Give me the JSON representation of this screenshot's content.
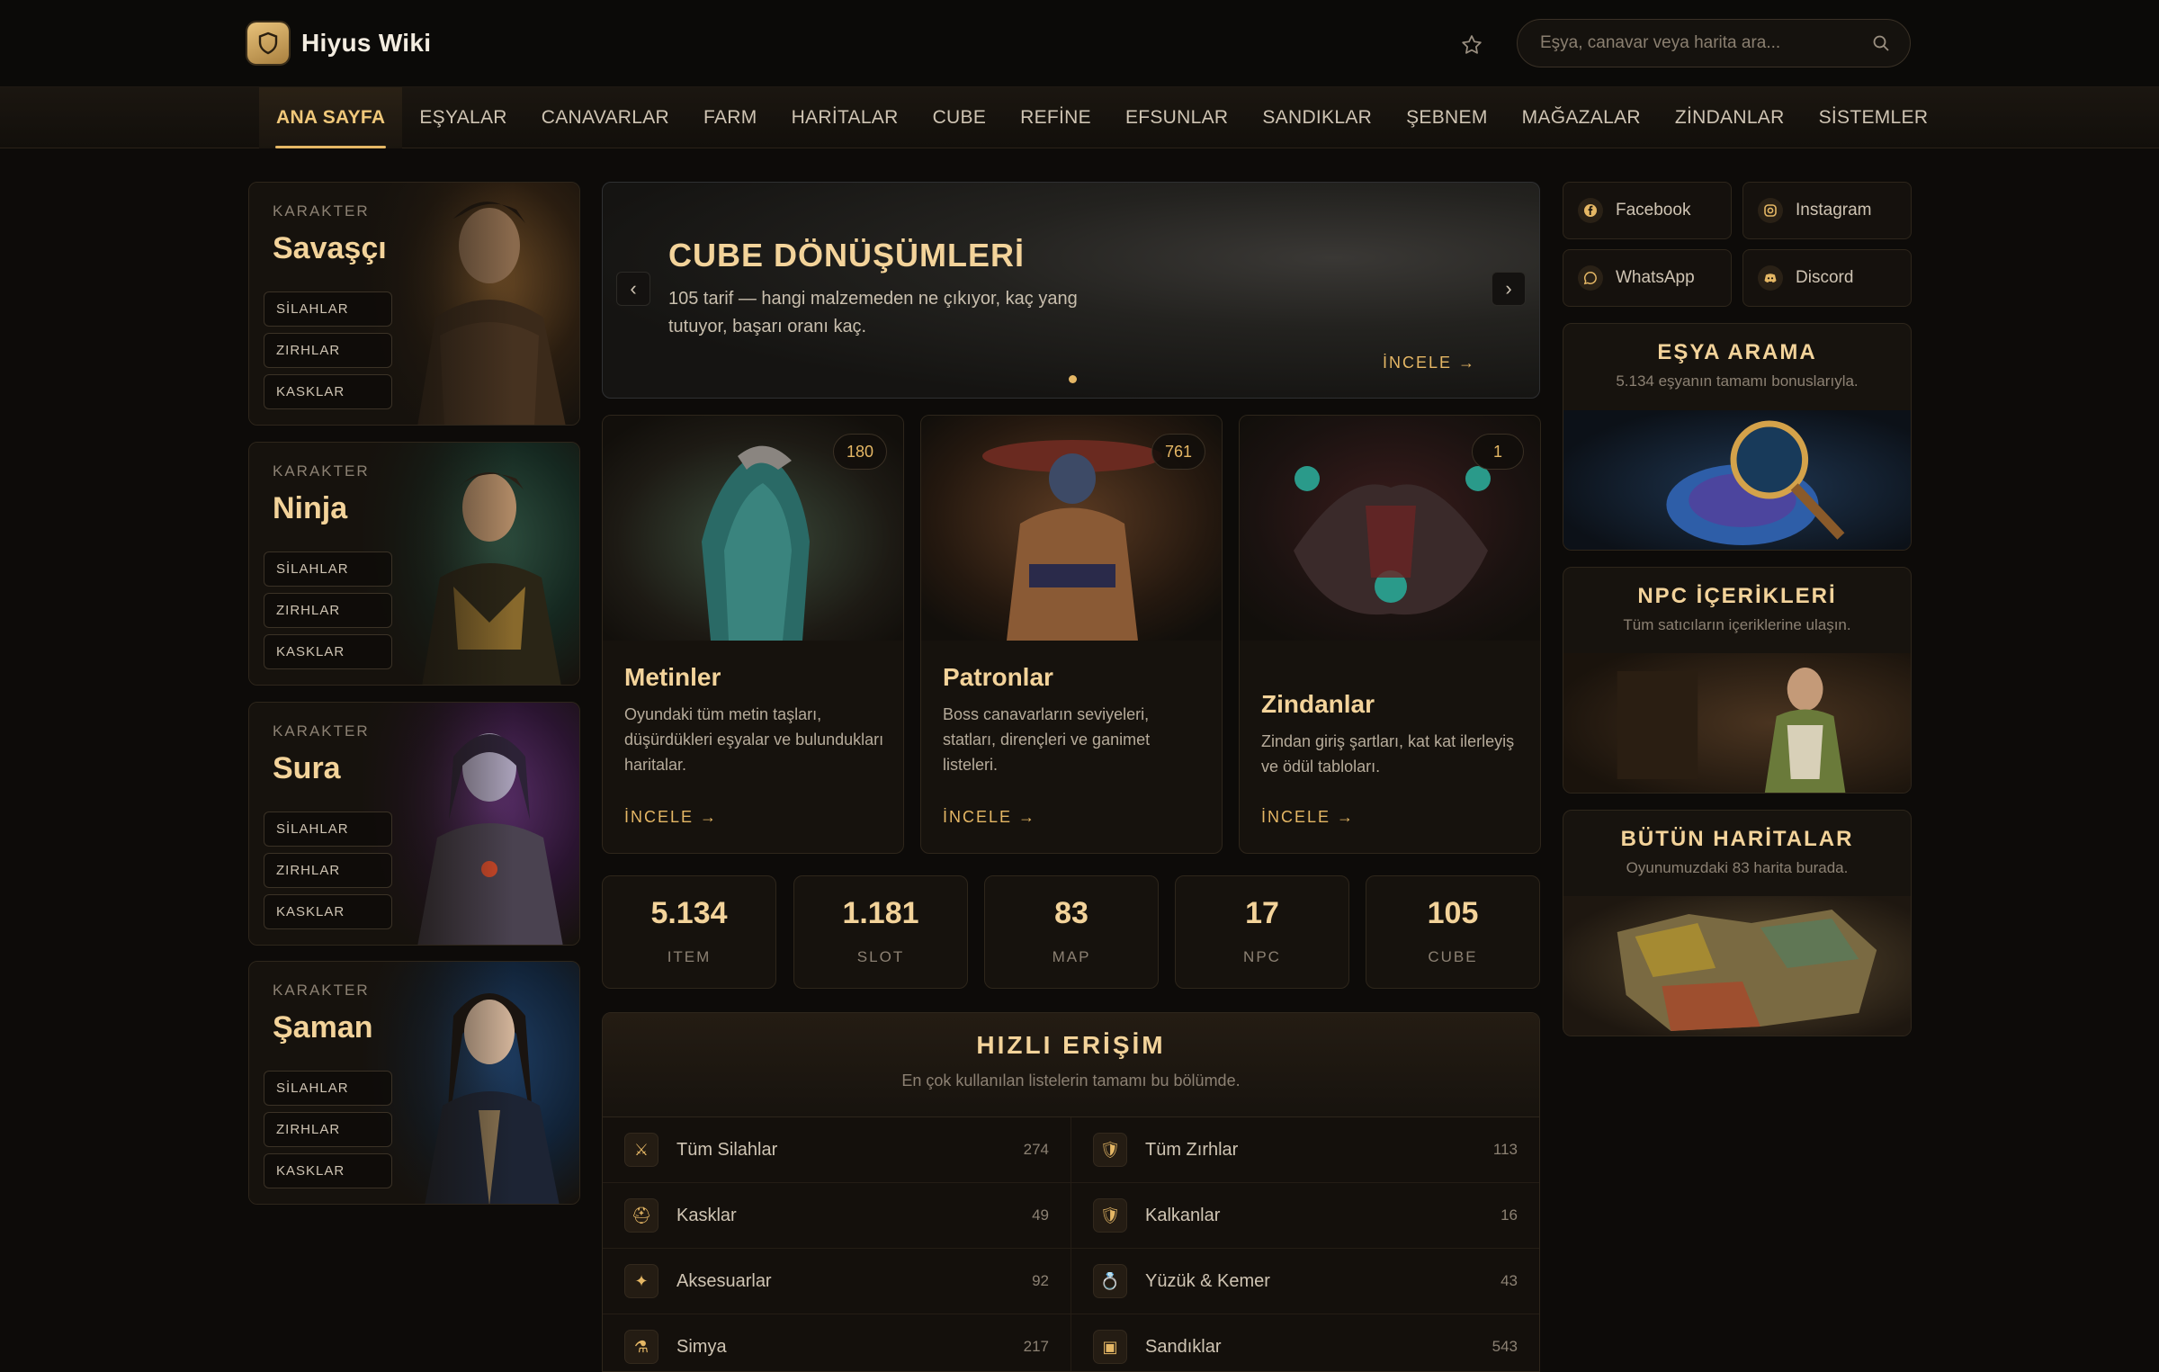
{
  "header": {
    "brand": "Hiyus Wiki",
    "search_placeholder": "Eşya, canavar veya harita ara..."
  },
  "nav": {
    "items": [
      "ANA SAYFA",
      "EŞYALAR",
      "CANAVARLAR",
      "FARM",
      "HARİTALAR",
      "CUBE",
      "REFİNE",
      "EFSUNLAR",
      "SANDIKLAR",
      "ŞEBNEM",
      "MAĞAZALAR",
      "ZİNDANLAR",
      "SİSTEMLER"
    ],
    "active": "ANA SAYFA"
  },
  "characters": [
    {
      "kicker": "KARAKTER",
      "name": "Savaşçı",
      "buttons": [
        "SİLAHLAR",
        "ZIRHLAR",
        "KASKLAR"
      ]
    },
    {
      "kicker": "KARAKTER",
      "name": "Ninja",
      "buttons": [
        "SİLAHLAR",
        "ZIRHLAR",
        "KASKLAR"
      ]
    },
    {
      "kicker": "KARAKTER",
      "name": "Sura",
      "buttons": [
        "SİLAHLAR",
        "ZIRHLAR",
        "KASKLAR"
      ]
    },
    {
      "kicker": "KARAKTER",
      "name": "Şaman",
      "buttons": [
        "SİLAHLAR",
        "ZIRHLAR",
        "KASKLAR"
      ]
    }
  ],
  "hero": {
    "title": "CUBE DÖNÜŞÜMLERİ",
    "description": "105 tarif — hangi malzemeden ne çıkıyor, kaç yang tutuyor, başarı oranı kaç.",
    "link": "İNCELE →",
    "prev": "‹",
    "next": "›"
  },
  "features": [
    {
      "title": "Metinler",
      "count": "180",
      "description": "Oyundaki tüm metin taşları, düşürdükleri eşyalar ve bulundukları haritalar.",
      "link": "İNCELE →"
    },
    {
      "title": "Patronlar",
      "count": "761",
      "description": "Boss canavarların seviyeleri, statları, dirençleri ve ganimet listeleri.",
      "link": "İNCELE →"
    },
    {
      "title": "Zindanlar",
      "count": "1",
      "description": "Zindan giriş şartları, kat kat ilerleyiş ve ödül tabloları.",
      "link": "İNCELE →"
    }
  ],
  "stats": [
    {
      "value": "5.134",
      "label": "ITEM"
    },
    {
      "value": "1.181",
      "label": "SLOT"
    },
    {
      "value": "83",
      "label": "MAP"
    },
    {
      "value": "17",
      "label": "NPC"
    },
    {
      "value": "105",
      "label": "CUBE"
    }
  ],
  "quick_access": {
    "title": "HIZLI ERİŞİM",
    "subtitle": "En çok kullanılan listelerin tamamı bu bölümde.",
    "items": [
      {
        "label": "Tüm Silahlar",
        "count": "274",
        "icon": "⚔"
      },
      {
        "label": "Tüm Zırhlar",
        "count": "113",
        "icon": "🛡"
      },
      {
        "label": "Kasklar",
        "count": "49",
        "icon": "⛑"
      },
      {
        "label": "Kalkanlar",
        "count": "16",
        "icon": "🛡"
      },
      {
        "label": "Aksesuarlar",
        "count": "92",
        "icon": "✦"
      },
      {
        "label": "Yüzük & Kemer",
        "count": "43",
        "icon": "💍"
      },
      {
        "label": "Simya",
        "count": "217",
        "icon": "⚗"
      },
      {
        "label": "Sandıklar",
        "count": "543",
        "icon": "▣"
      }
    ]
  },
  "social": [
    {
      "label": "Facebook",
      "icon": "facebook-icon"
    },
    {
      "label": "Instagram",
      "icon": "instagram-icon"
    },
    {
      "label": "WhatsApp",
      "icon": "whatsapp-icon"
    },
    {
      "label": "Discord",
      "icon": "discord-icon"
    }
  ],
  "side_cards": [
    {
      "title": "EŞYA ARAMA",
      "subtitle": "5.134 eşyanın tamamı bonuslarıyla."
    },
    {
      "title": "NPC İÇERİKLERİ",
      "subtitle": "Tüm satıcıların içeriklerine ulaşın."
    },
    {
      "title": "BÜTÜN HARİTALAR",
      "subtitle": "Oyunumuzdaki 83 harita burada."
    }
  ],
  "colors": {
    "accent": "#e5b765",
    "title": "#f3d39a",
    "background": "#0d0b09"
  }
}
